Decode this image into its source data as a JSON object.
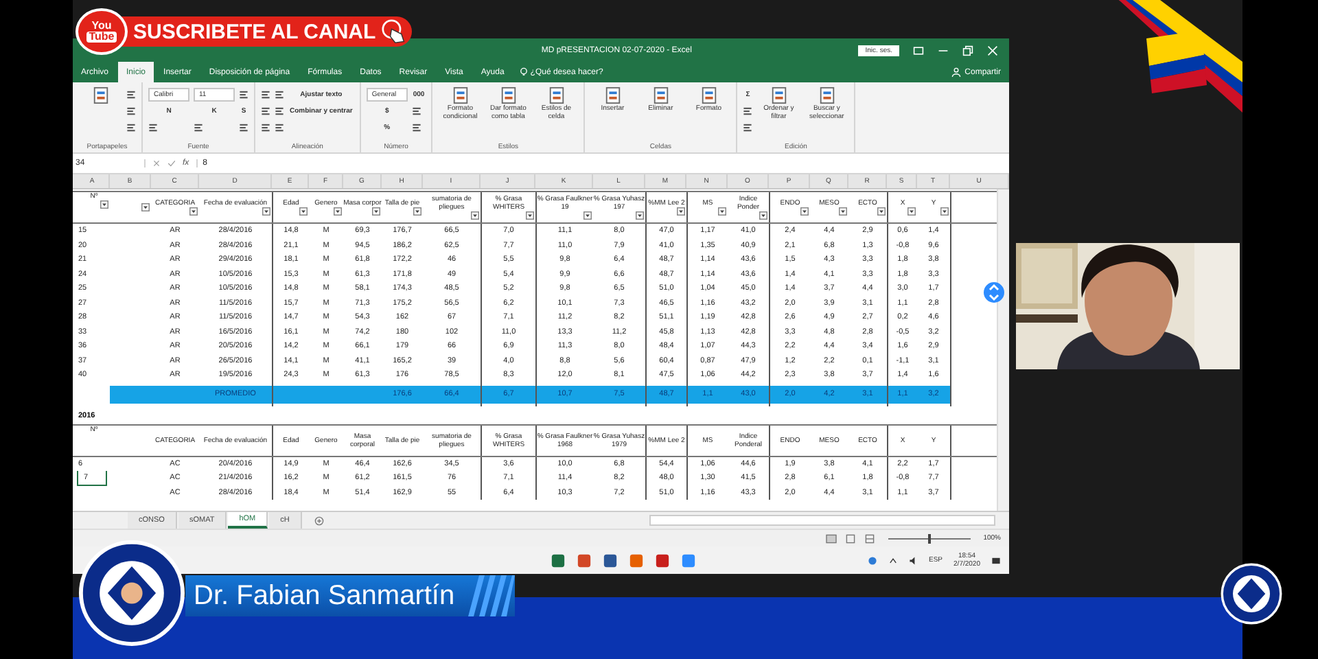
{
  "overlay": {
    "logo_top": "You",
    "logo_bottom": "Tube",
    "subscribe": "SUSCRIBETE AL CANAL",
    "presenter": "Dr. Fabian Sanmartín"
  },
  "window": {
    "title": "MD pRESENTACION 02-07-2020  -  Excel",
    "signin": "Inic. ses."
  },
  "tabs": [
    {
      "label": "Archivo",
      "selected": false
    },
    {
      "label": "Inicio",
      "selected": true
    },
    {
      "label": "Insertar",
      "selected": false
    },
    {
      "label": "Disposición de página",
      "selected": false
    },
    {
      "label": "Fórmulas",
      "selected": false
    },
    {
      "label": "Datos",
      "selected": false
    },
    {
      "label": "Revisar",
      "selected": false
    },
    {
      "label": "Vista",
      "selected": false
    },
    {
      "label": "Ayuda",
      "selected": false
    }
  ],
  "tell_me": "¿Qué desea hacer?",
  "share": "Compartir",
  "ribbon": [
    {
      "label": "Portapapeles",
      "items": [
        {
          "kind": "big"
        },
        {
          "kind": "icon"
        },
        {
          "kind": "icon"
        },
        {
          "kind": "icon"
        }
      ]
    },
    {
      "label": "Fuente",
      "items": [
        {
          "kind": "field",
          "label": "Calibri"
        },
        {
          "kind": "text",
          "label": "N"
        },
        {
          "kind": "icon"
        },
        {
          "kind": "field",
          "label": "11"
        },
        {
          "kind": "text",
          "label": "K"
        },
        {
          "kind": "icon"
        },
        {
          "kind": "icon"
        },
        {
          "kind": "text",
          "label": "S"
        },
        {
          "kind": "icon"
        }
      ]
    },
    {
      "label": "Alineación",
      "items": [
        {
          "kind": "icon"
        },
        {
          "kind": "icon"
        },
        {
          "kind": "icon"
        },
        {
          "kind": "icon"
        },
        {
          "kind": "icon"
        },
        {
          "kind": "icon"
        },
        {
          "kind": "text",
          "label": "Ajustar texto"
        },
        {
          "kind": "text",
          "label": "Combinar y centrar"
        }
      ]
    },
    {
      "label": "Número",
      "items": [
        {
          "kind": "field",
          "label": "General"
        },
        {
          "kind": "text",
          "label": "$"
        },
        {
          "kind": "text",
          "label": "%"
        },
        {
          "kind": "text",
          "label": "000"
        },
        {
          "kind": "icon"
        },
        {
          "kind": "icon"
        }
      ]
    },
    {
      "label": "Estilos",
      "items": [
        {
          "kind": "big",
          "label": "Formato condicional"
        },
        {
          "kind": "big",
          "label": "Dar formato como tabla"
        },
        {
          "kind": "big",
          "label": "Estilos de celda"
        }
      ]
    },
    {
      "label": "Celdas",
      "items": [
        {
          "kind": "big",
          "label": "Insertar"
        },
        {
          "kind": "big",
          "label": "Eliminar"
        },
        {
          "kind": "big",
          "label": "Formato"
        }
      ]
    },
    {
      "label": "Edición",
      "items": [
        {
          "kind": "text",
          "label": "Σ"
        },
        {
          "kind": "icon"
        },
        {
          "kind": "icon"
        },
        {
          "kind": "big",
          "label": "Ordenar y filtrar"
        },
        {
          "kind": "big",
          "label": "Buscar y seleccionar"
        }
      ]
    }
  ],
  "formula_bar": {
    "name_box": "34",
    "fx": "fx",
    "value": "8"
  },
  "column_letters": [
    "A",
    "B",
    "C",
    "D",
    "E",
    "F",
    "G",
    "H",
    "I",
    "J",
    "K",
    "L",
    "M",
    "N",
    "O",
    "P",
    "Q",
    "R",
    "S",
    "T",
    "U"
  ],
  "tables": [
    {
      "filters": true,
      "headers": [
        "Nº",
        "CATEGORIA",
        "Fecha de evaluación",
        "Edad",
        "Genero",
        "Masa corpor",
        "Talla de pie",
        "sumatoria de pliegues",
        "% Grasa WHITERS",
        "% Grasa Faulkner 19",
        "% Grasa Yuhasz 197",
        "%MM Lee 2",
        "MS",
        "Indice Ponder",
        "ENDO",
        "MESO",
        "ECTO",
        "X",
        "Y"
      ],
      "rows": [
        {
          "kind": "data",
          "cells": [
            "15",
            null,
            "AR",
            "28/4/2016",
            "14,8",
            "M",
            "69,3",
            "176,7",
            "66,5",
            "7,0",
            "11,1",
            "8,0",
            "47,0",
            "1,17",
            "41,0",
            "2,4",
            "4,4",
            "2,9",
            "0,6",
            "1,4"
          ]
        },
        {
          "kind": "data",
          "cells": [
            "20",
            null,
            "AR",
            "28/4/2016",
            "21,1",
            "M",
            "94,5",
            "186,2",
            "62,5",
            "7,7",
            "11,0",
            "7,9",
            "41,0",
            "1,35",
            "40,9",
            "2,1",
            "6,8",
            "1,3",
            "-0,8",
            "9,6"
          ]
        },
        {
          "kind": "data",
          "cells": [
            "21",
            null,
            "AR",
            "29/4/2016",
            "18,1",
            "M",
            "61,8",
            "172,2",
            "46",
            "5,5",
            "9,8",
            "6,4",
            "48,7",
            "1,14",
            "43,6",
            "1,5",
            "4,3",
            "3,3",
            "1,8",
            "3,8"
          ]
        },
        {
          "kind": "data",
          "cells": [
            "24",
            null,
            "AR",
            "10/5/2016",
            "15,3",
            "M",
            "61,3",
            "171,8",
            "49",
            "5,4",
            "9,9",
            "6,6",
            "48,7",
            "1,14",
            "43,6",
            "1,4",
            "4,1",
            "3,3",
            "1,8",
            "3,3"
          ]
        },
        {
          "kind": "data",
          "cells": [
            "25",
            null,
            "AR",
            "10/5/2016",
            "14,8",
            "M",
            "58,1",
            "174,3",
            "48,5",
            "5,2",
            "9,8",
            "6,5",
            "51,0",
            "1,04",
            "45,0",
            "1,4",
            "3,7",
            "4,4",
            "3,0",
            "1,7"
          ]
        },
        {
          "kind": "data",
          "cells": [
            "27",
            null,
            "AR",
            "11/5/2016",
            "15,7",
            "M",
            "71,3",
            "175,2",
            "56,5",
            "6,2",
            "10,1",
            "7,3",
            "46,5",
            "1,16",
            "43,2",
            "2,0",
            "3,9",
            "3,1",
            "1,1",
            "2,8"
          ]
        },
        {
          "kind": "data",
          "cells": [
            "28",
            null,
            "AR",
            "11/5/2016",
            "14,7",
            "M",
            "54,3",
            "162",
            "67",
            "7,1",
            "11,2",
            "8,2",
            "51,1",
            "1,19",
            "42,8",
            "2,6",
            "4,9",
            "2,7",
            "0,2",
            "4,6"
          ]
        },
        {
          "kind": "data",
          "cells": [
            "33",
            null,
            "AR",
            "16/5/2016",
            "16,1",
            "M",
            "74,2",
            "180",
            "102",
            "11,0",
            "13,3",
            "11,2",
            "45,8",
            "1,13",
            "42,8",
            "3,3",
            "4,8",
            "2,8",
            "-0,5",
            "3,2"
          ]
        },
        {
          "kind": "data",
          "cells": [
            "36",
            null,
            "AR",
            "20/5/2016",
            "14,2",
            "M",
            "66,1",
            "179",
            "66",
            "6,9",
            "11,3",
            "8,0",
            "48,4",
            "1,07",
            "44,3",
            "2,2",
            "4,4",
            "3,4",
            "1,6",
            "2,9"
          ]
        },
        {
          "kind": "data",
          "cells": [
            "37",
            null,
            "AR",
            "26/5/2016",
            "14,1",
            "M",
            "41,1",
            "165,2",
            "39",
            "4,0",
            "8,8",
            "5,6",
            "60,4",
            "0,87",
            "47,9",
            "1,2",
            "2,2",
            "0,1",
            "-1,1",
            "3,1"
          ]
        },
        {
          "kind": "data",
          "cells": [
            "40",
            null,
            "AR",
            "19/5/2016",
            "24,3",
            "M",
            "61,3",
            "176",
            "78,5",
            "8,3",
            "12,0",
            "8,1",
            "47,5",
            "1,06",
            "44,2",
            "2,3",
            "3,8",
            "3,7",
            "1,4",
            "1,6"
          ]
        },
        {
          "kind": "average",
          "cells": [
            null,
            null,
            null,
            "PROMEDIO",
            null,
            null,
            null,
            "176,6",
            "66,4",
            "6,7",
            "10,7",
            "7,5",
            "48,7",
            "1,1",
            "43,0",
            "2,0",
            "4,2",
            "3,1",
            "1,1",
            "3,2"
          ]
        }
      ]
    },
    {
      "title": "2016",
      "filters": false,
      "headers": [
        "Nº",
        "CATEGORIA",
        "Fecha de evaluación",
        "Edad",
        "Genero",
        "Masa corporal",
        "Talla de pie",
        "sumatoria de pliegues",
        "% Grasa WHITERS",
        "% Grasa Faulkner 1968",
        "% Grasa Yuhasz 1979",
        "%MM Lee 2",
        "MS",
        "Indice Ponderal",
        "ENDO",
        "MESO",
        "ECTO",
        "X",
        "Y"
      ],
      "rows": [
        {
          "kind": "data",
          "cells": [
            "6",
            null,
            "AC",
            "20/4/2016",
            "14,9",
            "M",
            "46,4",
            "162,6",
            "34,5",
            "3,6",
            "10,0",
            "6,8",
            "54,4",
            "1,06",
            "44,6",
            "1,9",
            "3,8",
            "4,1",
            "2,2",
            "1,7"
          ]
        },
        {
          "kind": "data",
          "selected": true,
          "cells": [
            "7",
            null,
            "AC",
            "21/4/2016",
            "16,2",
            "M",
            "61,2",
            "161,5",
            "76",
            "7,1",
            "11,4",
            "8,2",
            "48,0",
            "1,30",
            "41,5",
            "2,8",
            "6,1",
            "1,8",
            "-0,8",
            "7,7"
          ]
        },
        {
          "kind": "data",
          "cells": [
            null,
            null,
            "AC",
            "28/4/2016",
            "18,4",
            "M",
            "51,4",
            "162,9",
            "55",
            "6,4",
            "10,3",
            "7,2",
            "51,0",
            "1,16",
            "43,3",
            "2,0",
            "4,4",
            "3,1",
            "1,1",
            "3,7"
          ]
        }
      ]
    }
  ],
  "sheets": [
    {
      "label": "cONSO",
      "selected": false
    },
    {
      "label": "sOMAT",
      "selected": false
    },
    {
      "label": "hOM",
      "selected": true
    },
    {
      "label": "cH",
      "selected": false
    }
  ],
  "status": {
    "zoom": "100%",
    "zoom_slider": {
      "level": 0.5
    }
  },
  "taskbar": {
    "apps": [
      {
        "kind": "excel"
      },
      {
        "kind": "powerpoint"
      },
      {
        "kind": "word"
      },
      {
        "kind": "firefox"
      },
      {
        "kind": "pdf"
      },
      {
        "kind": "zoom"
      }
    ],
    "language": "ESP",
    "time": "18:54",
    "date": "2/7/2020"
  }
}
